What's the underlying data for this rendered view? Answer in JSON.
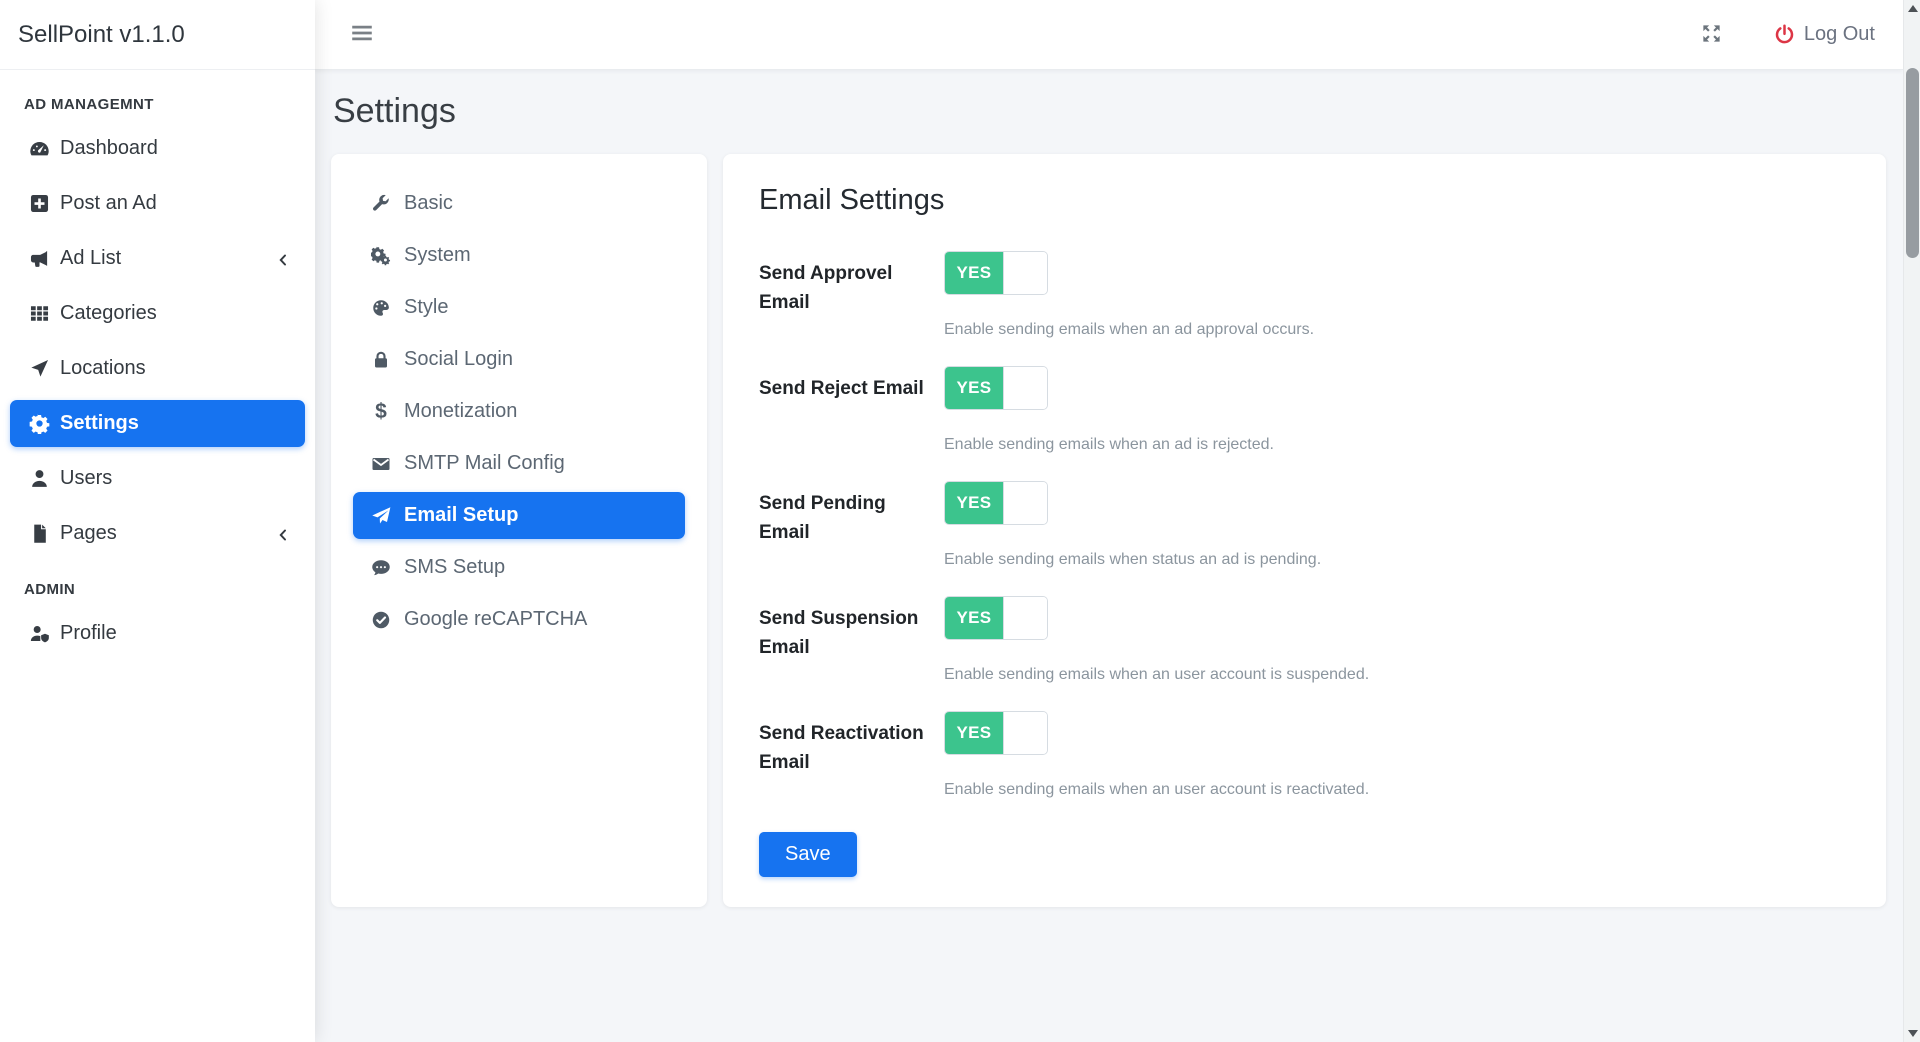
{
  "app": {
    "brand": "SellPoint v1.1.0"
  },
  "topbar": {
    "logout_label": "Log Out"
  },
  "page": {
    "title": "Settings"
  },
  "sidebar": {
    "sections": [
      {
        "heading": "AD MANAGEMNT",
        "items": [
          {
            "label": "Dashboard",
            "icon": "tachometer-icon",
            "active": false
          },
          {
            "label": "Post an Ad",
            "icon": "plus-square-icon",
            "active": false
          },
          {
            "label": "Ad List",
            "icon": "bullhorn-icon",
            "active": false,
            "chevron": true
          },
          {
            "label": "Categories",
            "icon": "grid-icon",
            "active": false
          },
          {
            "label": "Locations",
            "icon": "location-arrow-icon",
            "active": false
          },
          {
            "label": "Settings",
            "icon": "gear-icon",
            "active": true
          },
          {
            "label": "Users",
            "icon": "user-icon",
            "active": false
          },
          {
            "label": "Pages",
            "icon": "file-icon",
            "active": false,
            "chevron": true
          }
        ]
      },
      {
        "heading": "ADMIN",
        "items": [
          {
            "label": "Profile",
            "icon": "user-shield-icon",
            "active": false
          }
        ]
      }
    ]
  },
  "settings_nav": {
    "items": [
      {
        "label": "Basic",
        "icon": "wrench-icon",
        "active": false
      },
      {
        "label": "System",
        "icon": "cogs-icon",
        "active": false
      },
      {
        "label": "Style",
        "icon": "palette-icon",
        "active": false
      },
      {
        "label": "Social Login",
        "icon": "lock-icon",
        "active": false
      },
      {
        "label": "Monetization",
        "icon": "dollar-icon",
        "active": false
      },
      {
        "label": "SMTP Mail Config",
        "icon": "envelope-icon",
        "active": false
      },
      {
        "label": "Email Setup",
        "icon": "paper-plane-icon",
        "active": true
      },
      {
        "label": "SMS Setup",
        "icon": "comment-dots-icon",
        "active": false
      },
      {
        "label": "Google reCAPTCHA",
        "icon": "check-circle-icon",
        "active": false
      }
    ]
  },
  "panel": {
    "title": "Email Settings",
    "rows": [
      {
        "label": "Send Approvel Email",
        "value": "YES",
        "help": "Enable sending emails when an ad approval occurs."
      },
      {
        "label": "Send Reject Email",
        "value": "YES",
        "help": "Enable sending emails when an ad is rejected."
      },
      {
        "label": "Send Pending Email",
        "value": "YES",
        "help": "Enable sending emails when status an ad is pending."
      },
      {
        "label": "Send Suspension Email",
        "value": "YES",
        "help": "Enable sending emails when an user account is suspended."
      },
      {
        "label": "Send Reactivation Email",
        "value": "YES",
        "help": "Enable sending emails when an user account is reactivated."
      }
    ],
    "save_label": "Save"
  },
  "colors": {
    "accent_blue": "#1673f0",
    "toggle_on_green": "#3cc48d",
    "logout_red": "#dc3545",
    "body_background": "#f4f6f9"
  }
}
